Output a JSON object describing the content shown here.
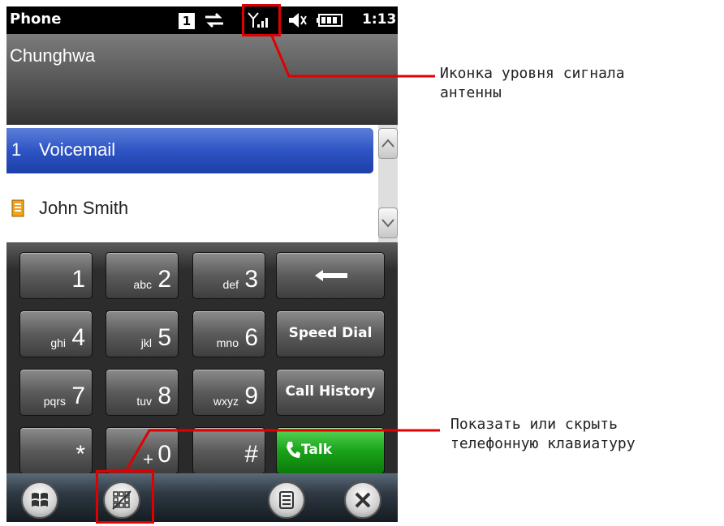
{
  "status_bar": {
    "app_title": "Phone",
    "notification_count": "1",
    "time": "1:13"
  },
  "carrier": "Chunghwa",
  "contact_list": [
    {
      "number": "1",
      "name": "Voicemail",
      "selected": true
    },
    {
      "number": "",
      "name": "John Smith",
      "icon": "contact-card-icon"
    }
  ],
  "keypad": {
    "keys": [
      {
        "digit": "1",
        "letters": ""
      },
      {
        "digit": "2",
        "letters": "abc"
      },
      {
        "digit": "3",
        "letters": "def"
      },
      {
        "digit": "4",
        "letters": "ghi"
      },
      {
        "digit": "5",
        "letters": "jkl"
      },
      {
        "digit": "6",
        "letters": "mno"
      },
      {
        "digit": "7",
        "letters": "pqrs"
      },
      {
        "digit": "8",
        "letters": "tuv"
      },
      {
        "digit": "9",
        "letters": "wxyz"
      },
      {
        "digit": "*",
        "letters": ""
      },
      {
        "digit": "0",
        "letters": "+"
      },
      {
        "digit": "#",
        "letters": ""
      }
    ],
    "speed_dial_label": "Speed Dial",
    "call_history_label": "Call History",
    "talk_label": "Talk",
    "backspace_icon": "backspace-arrow-icon"
  },
  "taskbar": {
    "icons": [
      "windows-start-icon",
      "keypad-toggle-icon",
      "menu-icon",
      "close-icon"
    ]
  },
  "annotations": {
    "signal_line1": "Иконка уровня сигнала",
    "signal_line2": "антенны",
    "keypad_line1": "Показать или скрыть",
    "keypad_line2": "телефонную клавиатуру"
  },
  "colors": {
    "highlight": "#e00000",
    "selection": "#2e54c4",
    "talk": "#1aa31a"
  }
}
